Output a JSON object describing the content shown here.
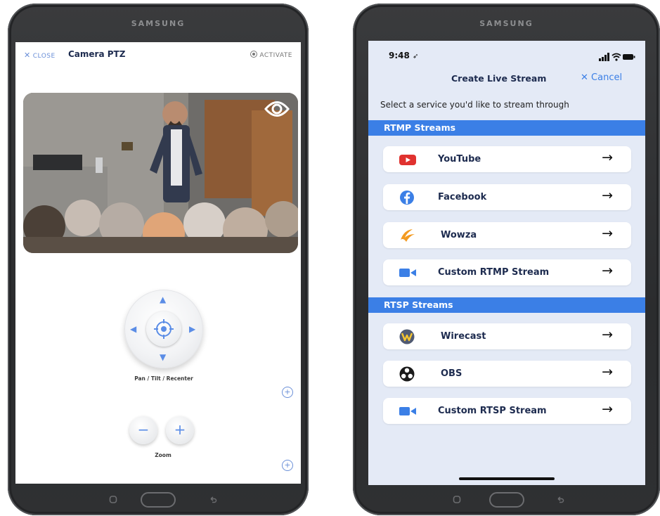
{
  "left_device": {
    "brand": "SAMSUNG",
    "header": {
      "close_label": "CLOSE",
      "title": "Camera PTZ",
      "activate_label": "ACTIVATE"
    },
    "pad_label": "Pan / Tilt / Recenter",
    "zoom": {
      "minus": "−",
      "plus": "+",
      "label": "Zoom"
    },
    "add_symbol": "+"
  },
  "right_device": {
    "brand": "SAMSUNG",
    "status": {
      "time": "9:48"
    },
    "title": "Create Live Stream",
    "cancel_label": "Cancel",
    "subtitle": "Select a service you'd like to stream through",
    "sections": [
      {
        "title": "RTMP Streams",
        "services": [
          {
            "label": "YouTube",
            "icon": "youtube-icon"
          },
          {
            "label": "Facebook",
            "icon": "facebook-icon"
          },
          {
            "label": "Wowza",
            "icon": "wowza-icon"
          },
          {
            "label": "Custom RTMP Stream",
            "icon": "video-camera-icon"
          }
        ]
      },
      {
        "title": "RTSP Streams",
        "services": [
          {
            "label": "Wirecast",
            "icon": "wirecast-icon"
          },
          {
            "label": "OBS",
            "icon": "obs-icon"
          },
          {
            "label": "Custom RTSP Stream",
            "icon": "video-camera-icon"
          }
        ]
      }
    ],
    "arrow": "→"
  },
  "colors": {
    "accent": "#3b7fe6",
    "section_bg": "#3b7fe6",
    "screen_bg": "#e4eaf6",
    "youtube": "#e0322f",
    "facebook": "#3b7fe6",
    "wowza": "#f39a20"
  }
}
